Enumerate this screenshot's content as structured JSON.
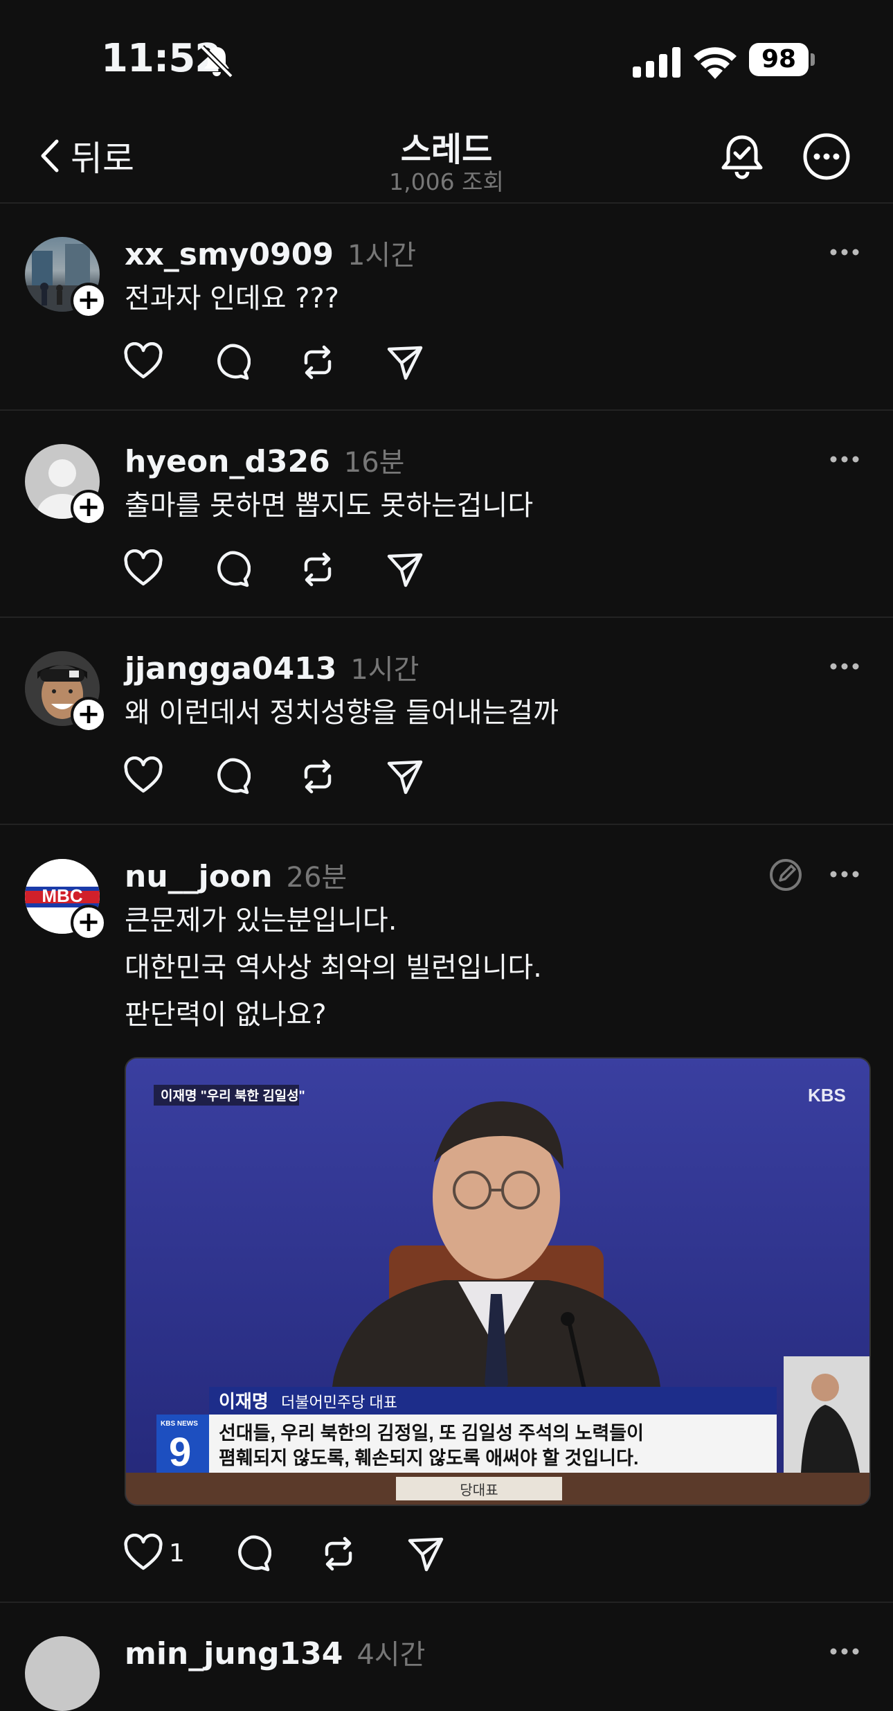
{
  "status": {
    "time": "11:52",
    "battery": "98"
  },
  "nav": {
    "back_label": "뒤로",
    "title": "스레드",
    "views": "1,006 조회"
  },
  "posts": [
    {
      "username": "xx_smy0909",
      "time": "1시간",
      "lines": [
        "전과자 인데요 ???"
      ],
      "likes": ""
    },
    {
      "username": "hyeon_d326",
      "time": "16분",
      "lines": [
        "출마를 못하면 뽑지도 못하는겁니다"
      ],
      "likes": ""
    },
    {
      "username": "jjangga0413",
      "time": "1시간",
      "lines": [
        "왜 이런데서 정치성향을 들어내는걸까"
      ],
      "likes": ""
    },
    {
      "username": "nu__joon",
      "time": "26분",
      "lines": [
        "큰문제가 있는분입니다.",
        "대한민국 역사상 최악의 빌런입니다.",
        "판단력이 없나요?"
      ],
      "likes": "1"
    },
    {
      "username": "min_jung134",
      "time": "4시간",
      "lines": [],
      "likes": ""
    }
  ],
  "media": {
    "top_caption": "이재명 \"우리 북한 김일성\"",
    "channel_logo": "KBS",
    "lower_third_name": "이재명",
    "lower_third_role": "더불어민주당 대표",
    "subtitle_line1": "선대들, 우리 북한의 김정일, 또 김일성 주석의 노력들이",
    "subtitle_line2": "폄훼되지 않도록, 훼손되지 않도록 애써야 할 것입니다.",
    "news_logo_small": "KBS NEWS",
    "news_number": "9",
    "nameplate": "당대표",
    "avatar4_text": "MBC"
  }
}
